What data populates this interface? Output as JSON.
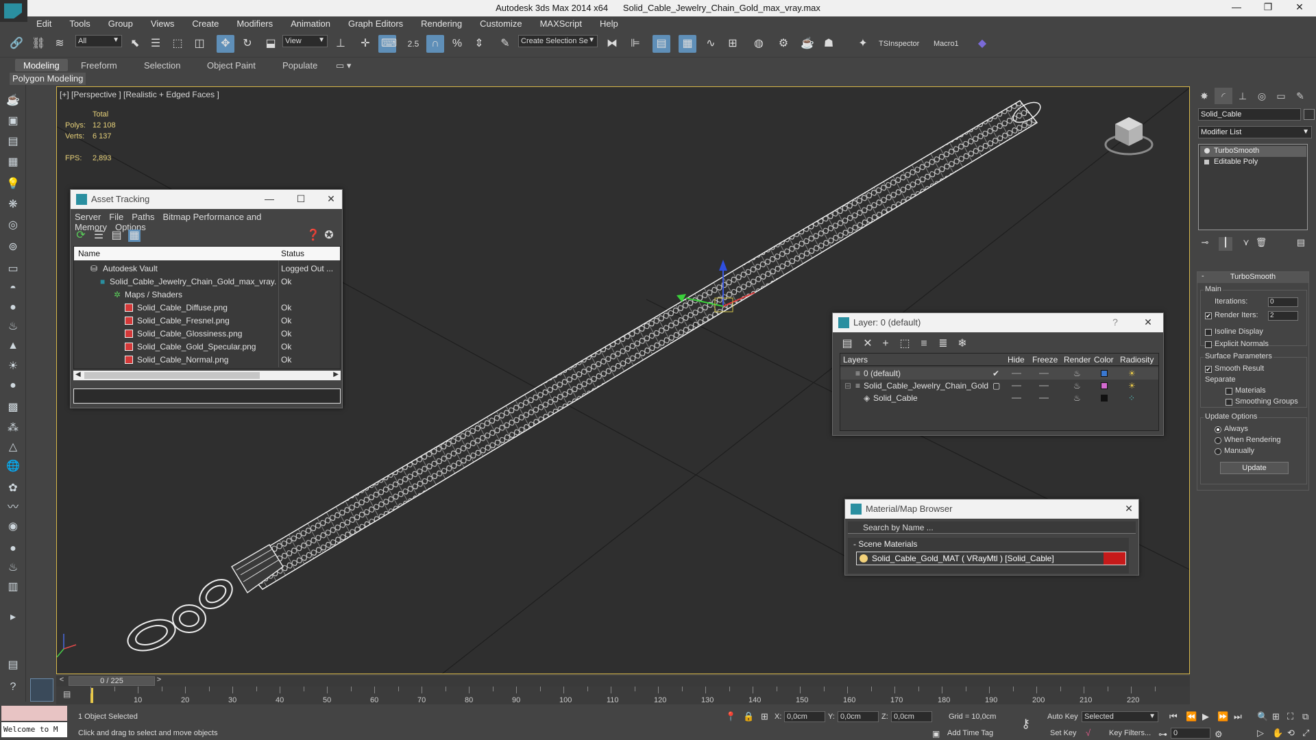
{
  "window": {
    "app_title": "Autodesk 3ds Max  2014 x64",
    "file_title": "Solid_Cable_Jewelry_Chain_Gold_max_vray.max",
    "controls": [
      "—",
      "❐",
      "✕"
    ]
  },
  "menu": [
    "Edit",
    "Tools",
    "Group",
    "Views",
    "Create",
    "Modifiers",
    "Animation",
    "Graph Editors",
    "Rendering",
    "Customize",
    "MAXScript",
    "Help"
  ],
  "toolbar": {
    "filter_value": "All",
    "refcoord_value": "View",
    "snap_value": "2.5",
    "named_selection_placeholder": "Create Selection Se",
    "ts_inspector": "TSInspector",
    "macro": "Macro1"
  },
  "ribbon": {
    "tabs": [
      "Modeling",
      "Freeform",
      "Selection",
      "Object Paint",
      "Populate"
    ],
    "sub_label": "Polygon Modeling"
  },
  "viewport": {
    "label": "[+] [Perspective ] [Realistic + Edged Faces ]",
    "stats": {
      "total_label": "Total",
      "polys_label": "Polys:",
      "polys_value": "12 108",
      "verts_label": "Verts:",
      "verts_value": "6 137",
      "fps_label": "FPS:",
      "fps_value": "2,893"
    }
  },
  "asset_tracking": {
    "title": "Asset Tracking",
    "menu": [
      "Server",
      "File",
      "Paths",
      "Bitmap Performance and Memory",
      "Options"
    ],
    "col_name": "Name",
    "col_status": "Status",
    "rows": [
      {
        "name": "Autodesk Vault",
        "status": "Logged Out ..."
      },
      {
        "name": "Solid_Cable_Jewelry_Chain_Gold_max_vray....",
        "status": "Ok"
      },
      {
        "name": "Maps / Shaders",
        "status": ""
      },
      {
        "name": "Solid_Cable_Diffuse.png",
        "status": "Ok"
      },
      {
        "name": "Solid_Cable_Fresnel.png",
        "status": "Ok"
      },
      {
        "name": "Solid_Cable_Glossiness.png",
        "status": "Ok"
      },
      {
        "name": "Solid_Cable_Gold_Specular.png",
        "status": "Ok"
      },
      {
        "name": "Solid_Cable_Normal.png",
        "status": "Ok"
      }
    ]
  },
  "layer_manager": {
    "title": "Layer: 0 (default)",
    "help": "?",
    "headers": [
      "Layers",
      "Hide",
      "Freeze",
      "Render",
      "Color",
      "Radiosity"
    ],
    "rows": [
      {
        "name": "0 (default)",
        "color": "#3a78d0"
      },
      {
        "name": "Solid_Cable_Jewelry_Chain_Gold",
        "color": "#d46ad0"
      },
      {
        "name": "Solid_Cable",
        "color": "#111111"
      }
    ]
  },
  "material_browser": {
    "title": "Material/Map Browser",
    "search_placeholder": "Search by Name ...",
    "section": "Scene Materials",
    "material": "Solid_Cable_Gold_MAT ( VRayMtl ) [Solid_Cable]"
  },
  "command_panel": {
    "object_name": "Solid_Cable",
    "modifier_list": "Modifier List",
    "stack": [
      "TurboSmooth",
      "Editable Poly"
    ],
    "rollout_title": "TurboSmooth",
    "main_group": "Main",
    "iterations_label": "Iterations:",
    "iterations_value": "0",
    "render_iters_label": "Render Iters:",
    "render_iters_value": "2",
    "isoline_label": "Isoline Display",
    "explicit_label": "Explicit Normals",
    "surface_group": "Surface Parameters",
    "smooth_result_label": "Smooth Result",
    "separate_label": "Separate",
    "materials_label": "Materials",
    "smoothing_groups_label": "Smoothing Groups",
    "update_group": "Update Options",
    "always_label": "Always",
    "when_rendering_label": "When Rendering",
    "manually_label": "Manually",
    "update_button": "Update"
  },
  "timeline": {
    "frame_display": "0 / 225",
    "ticks": [
      "10",
      "20",
      "30",
      "40",
      "50",
      "60",
      "70",
      "80",
      "90",
      "100",
      "110",
      "120",
      "130",
      "140",
      "150",
      "160",
      "170",
      "180",
      "190",
      "200",
      "210",
      "220"
    ]
  },
  "status": {
    "listener_text": "Welcome to M",
    "selection": "1 Object Selected",
    "prompt": "Click and drag to select and move objects",
    "x_label": "X:",
    "x_value": "0,0cm",
    "y_label": "Y:",
    "y_value": "0,0cm",
    "z_label": "Z:",
    "z_value": "0,0cm",
    "grid": "Grid = 10,0cm",
    "add_time_tag": "Add Time Tag",
    "auto_key": "Auto Key",
    "set_key": "Set Key",
    "selected_value": "Selected",
    "key_filters": "Key Filters...",
    "frame_value": "0"
  }
}
